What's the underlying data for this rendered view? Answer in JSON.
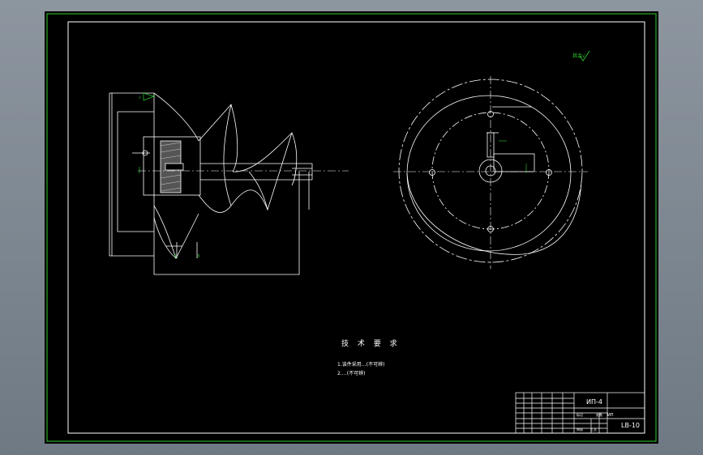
{
  "drawing": {
    "tech_requirements_title": "技 术 要 求",
    "tech_notes": [
      "1.该件采用…(不可辨)",
      "2.…(不可辨)"
    ],
    "title_block": {
      "drawing_number": "ИП-4",
      "code": "LB-10",
      "cell_1": "ИП",
      "cell_2": "标记",
      "cell_3": "处数",
      "cell_4": "审核",
      "cell_5": "工艺"
    },
    "roughness_note": "其余√"
  },
  "colors": {
    "background": "#000000",
    "line": "#ffffff",
    "frame_green": "#2fd12f",
    "accent_green": "#2fd12f"
  }
}
